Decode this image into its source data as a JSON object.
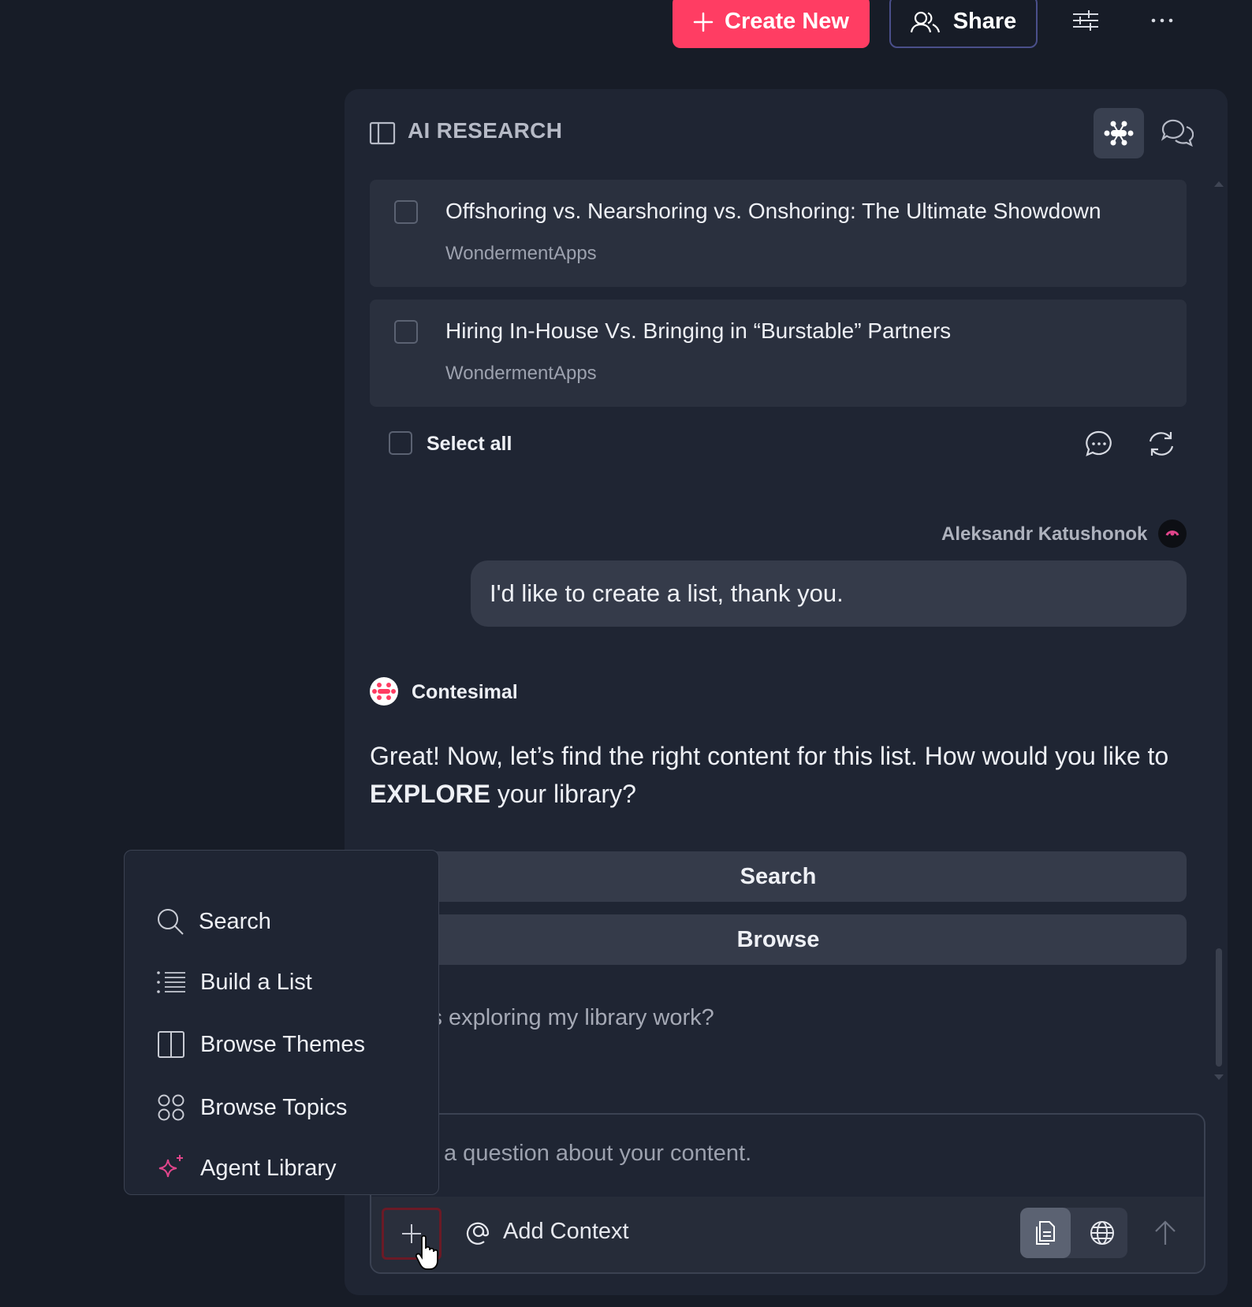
{
  "header": {
    "create_label": "Create New",
    "share_label": "Share"
  },
  "panel": {
    "title": "AI RESEARCH",
    "cards": [
      {
        "title": "Offshoring vs. Nearshoring vs. Onshoring: The Ultimate Showdown",
        "source": "WondermentApps"
      },
      {
        "title": "Hiring In-House Vs. Bringing in “Burstable” Partners",
        "source": "WondermentApps"
      }
    ],
    "select_all_label": "Select all"
  },
  "chat": {
    "user_name": "Aleksandr Katushonok",
    "user_message": "I'd like to create a list, thank you.",
    "bot_name": "Contesimal",
    "bot_message_before": "Great! Now, let’s find the right content for this list. How would you like to ",
    "bot_message_bold": "EXPLORE",
    "bot_message_after": " your library?",
    "options": [
      "Search",
      "Browse"
    ],
    "followup_visible": "w does exploring my library work?"
  },
  "input": {
    "placeholder_visible": "a question about your content.",
    "add_context_label": "Add Context"
  },
  "menu": {
    "items": [
      {
        "label": "Search",
        "icon": "search-icon"
      },
      {
        "label": "Build a List",
        "icon": "list-icon"
      },
      {
        "label": "Browse Themes",
        "icon": "columns-icon"
      },
      {
        "label": "Browse Topics",
        "icon": "grid-circles-icon"
      },
      {
        "label": "Agent Library",
        "icon": "sparkle-icon"
      }
    ]
  },
  "colors": {
    "accent": "#ff3d63",
    "background": "#171c27",
    "panel": "#1f2533",
    "sparkle": "#e0458b"
  }
}
